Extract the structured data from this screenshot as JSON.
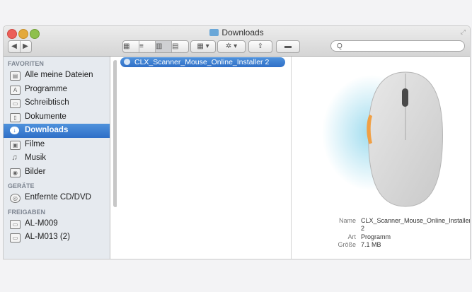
{
  "window": {
    "title": "Downloads"
  },
  "toolbar": {
    "search_placeholder": "Q"
  },
  "sidebar": {
    "sections": [
      {
        "header": "FAVORITEN",
        "items": [
          {
            "label": "Alle meine Dateien",
            "icon": "all-files-icon"
          },
          {
            "label": "Programme",
            "icon": "applications-icon"
          },
          {
            "label": "Schreibtisch",
            "icon": "desktop-icon"
          },
          {
            "label": "Dokumente",
            "icon": "documents-icon"
          },
          {
            "label": "Downloads",
            "icon": "downloads-icon",
            "selected": true
          },
          {
            "label": "Filme",
            "icon": "movies-icon"
          },
          {
            "label": "Musik",
            "icon": "music-icon"
          },
          {
            "label": "Bilder",
            "icon": "pictures-icon"
          }
        ]
      },
      {
        "header": "GERÄTE",
        "items": [
          {
            "label": "Entfernte CD/DVD",
            "icon": "remote-disc-icon"
          }
        ]
      },
      {
        "header": "FREIGABEN",
        "items": [
          {
            "label": "AL-M009",
            "icon": "computer-icon"
          },
          {
            "label": "AL-M013 (2)",
            "icon": "computer-icon"
          }
        ]
      }
    ]
  },
  "files": [
    {
      "name": "CLX_Scanner_Mouse_Online_Installer 2",
      "selected": true
    }
  ],
  "preview": {
    "name_label": "Name",
    "name_value": "CLX_Scanner_Mouse_Online_Installer 2",
    "kind_label": "Art",
    "kind_value": "Programm",
    "size_label": "Größe",
    "size_value": "7.1 MB"
  },
  "colors": {
    "accent": "#2f6fc7",
    "sidebar_bg": "#e6eaef",
    "mouse_glow": "#8fd6ec",
    "mouse_button": "#f0a045"
  }
}
